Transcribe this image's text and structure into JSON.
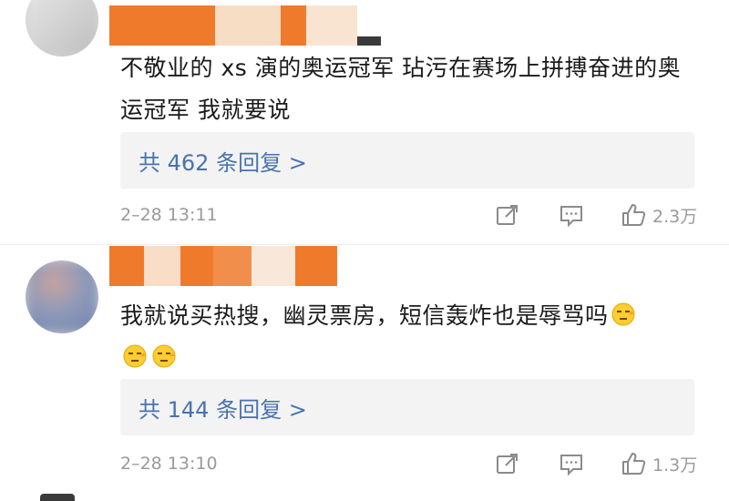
{
  "comments": [
    {
      "text": "不敬业的 xs 演的奥运冠军 玷污在赛场上拼搏奋进的奥运冠军 我就要说",
      "replies_label": "共 462 条回复 >",
      "date": "2–28 13:11",
      "likes": "2.3万"
    },
    {
      "text": "我就说买热搜，幽灵票房，短信轰炸也是辱骂吗",
      "replies_label": "共 144 条回复 >",
      "date": "2–28 13:10",
      "likes": "1.3万"
    }
  ],
  "colors": {
    "reply_link": "#4a72b0",
    "redaction_orange": "#f07a2c",
    "meta_gray": "#9a9a9a"
  },
  "icons": [
    "share-icon",
    "comment-icon",
    "like-icon",
    "speechless-emoji-icon"
  ]
}
